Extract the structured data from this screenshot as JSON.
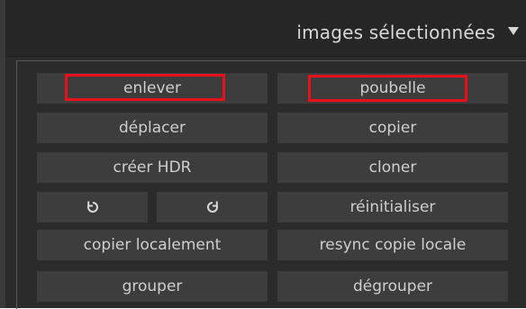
{
  "header": {
    "title": "images sélectionnées",
    "arrow_icon": "triangle-down-icon"
  },
  "buttons": {
    "remove": "enlever",
    "trash": "poubelle",
    "move": "déplacer",
    "copy": "copier",
    "create_hdr": "créer HDR",
    "duplicate": "cloner",
    "rotate_ccw_icon": "rotate-counterclockwise-icon",
    "rotate_cw_icon": "rotate-clockwise-icon",
    "reset": "réinitialiser",
    "copy_locally": "copier localement",
    "resync_local_copy": "resync copie locale",
    "group": "grouper",
    "ungroup": "dégrouper"
  },
  "colors": {
    "panel_bg": "#2b2b2b",
    "button_bg": "#3d3d3d",
    "text": "#cfcfcf",
    "highlight": "#e8101a"
  }
}
